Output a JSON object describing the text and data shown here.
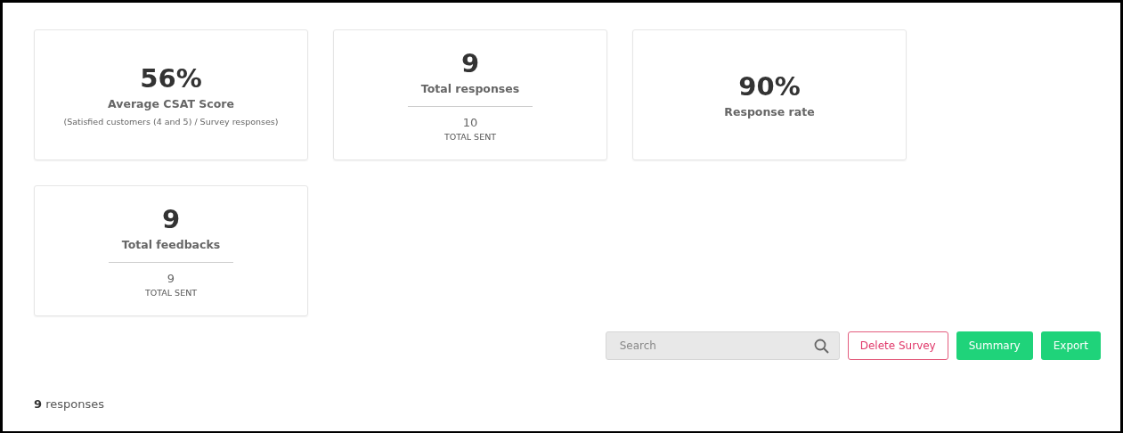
{
  "cards": [
    {
      "kind": "note",
      "value": "56%",
      "label": "Average CSAT Score",
      "note": "(Satisfied customers (4 and 5) / Survey responses)"
    },
    {
      "kind": "split",
      "value": "9",
      "label": "Total responses",
      "sub_value": "10",
      "sub_label": "TOTAL SENT"
    },
    {
      "kind": "simple",
      "value": "90%",
      "label": "Response rate"
    },
    {
      "kind": "split",
      "value": "9",
      "label": "Total feedbacks",
      "sub_value": "9",
      "sub_label": "TOTAL SENT"
    }
  ],
  "toolbar": {
    "search": {
      "placeholder": "Search"
    },
    "buttons": [
      {
        "kind": "danger",
        "label": "Delete Survey"
      },
      {
        "kind": "primary",
        "label": "Summary"
      },
      {
        "kind": "primary",
        "label": "Export"
      }
    ]
  },
  "summary": "**9** responses"
}
